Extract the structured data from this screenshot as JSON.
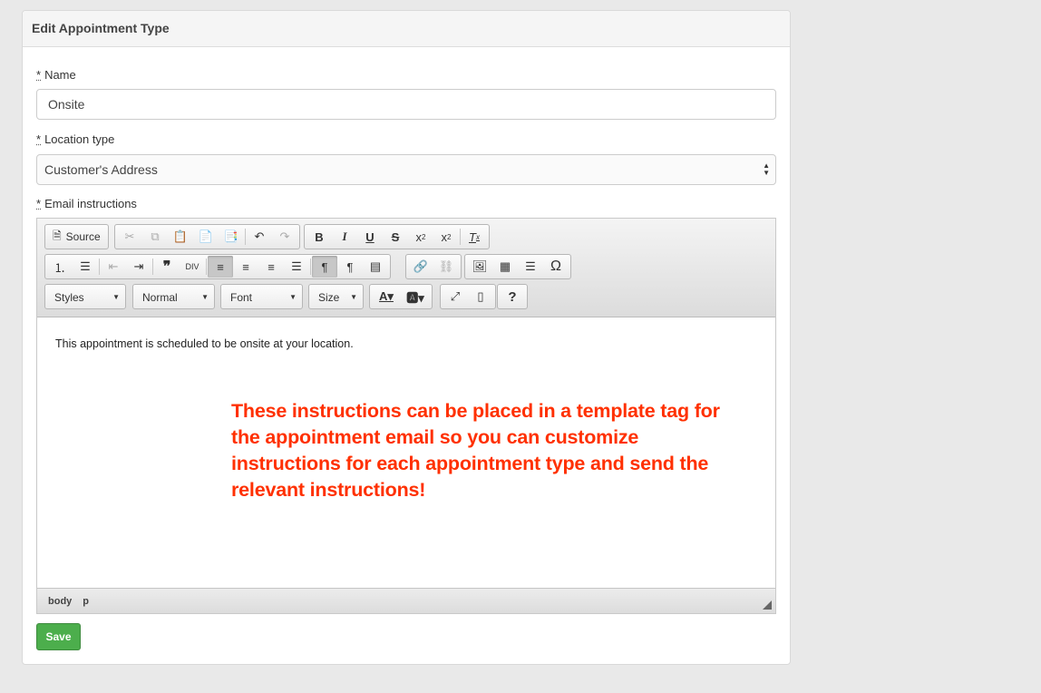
{
  "panel": {
    "title": "Edit Appointment Type"
  },
  "form": {
    "required_marker": "*",
    "name_label": "Name",
    "name_value": "Onsite",
    "location_label": "Location type",
    "location_value": "Customer's Address",
    "email_label": "Email instructions"
  },
  "editor": {
    "source_label": "Source",
    "styles_label": "Styles",
    "format_label": "Normal",
    "font_label": "Font",
    "size_label": "Size",
    "body_text": "This appointment is scheduled to be onsite at your location.",
    "path": [
      "body",
      "p"
    ]
  },
  "annotation": "These instructions can be placed in a template tag for the appointment email so you can customize instructions for each appointment type and send the relevant instructions!",
  "save_label": "Save",
  "colors": {
    "annotation": "#ff3000",
    "save": "#4cae4c"
  }
}
